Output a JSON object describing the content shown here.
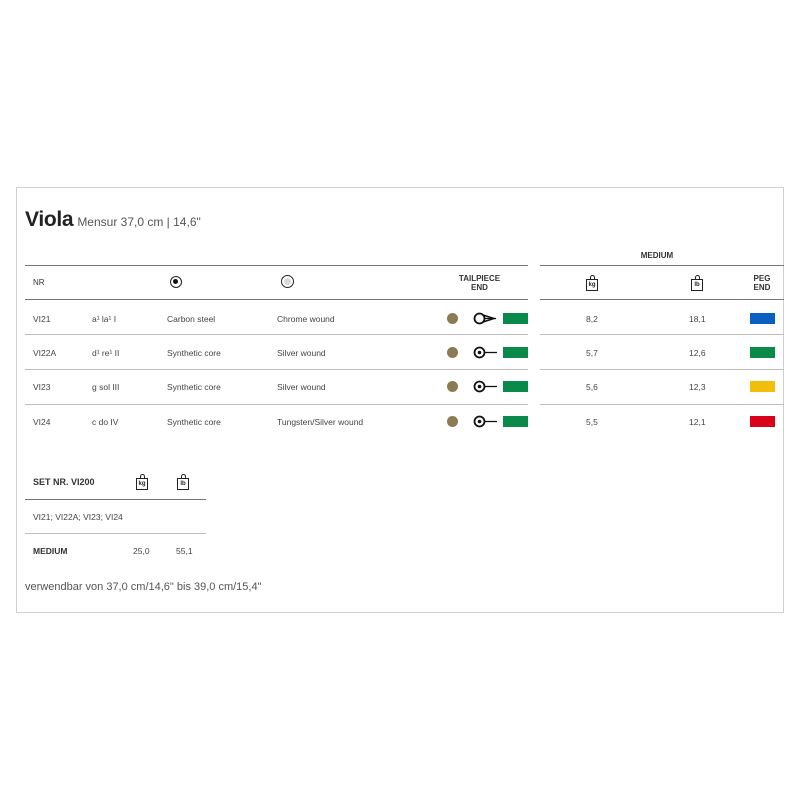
{
  "title": {
    "name": "Viola",
    "subtitle": "Mensur 37,0 cm | 14,6\""
  },
  "header": {
    "nr": "NR",
    "tailpiece_end": [
      "TAILPIECE",
      "END"
    ],
    "medium": "MEDIUM",
    "kg": "kg",
    "lb": "lb",
    "peg_end": [
      "PEG",
      "END"
    ]
  },
  "rows": [
    {
      "nr": "VI21",
      "note": "a¹  la¹  I",
      "core": "Carbon steel",
      "winding": "Chrome wound",
      "tailpiece_icon": "loop-arrow-icon",
      "kg": "8,2",
      "lb": "18,1",
      "peg_color": "#0a5fc0"
    },
    {
      "nr": "VI22A",
      "note": "d¹  re¹  II",
      "core": "Synthetic core",
      "winding": "Silver wound",
      "tailpiece_icon": "ball-end-icon",
      "kg": "5,7",
      "lb": "12,6",
      "peg_color": "#0a8a4a"
    },
    {
      "nr": "VI23",
      "note": "g  sol  III",
      "core": "Synthetic core",
      "winding": "Silver wound",
      "tailpiece_icon": "ball-end-icon",
      "kg": "5,6",
      "lb": "12,3",
      "peg_color": "#f2be0c"
    },
    {
      "nr": "VI24",
      "note": "c  do  IV",
      "core": "Synthetic core",
      "winding": "Tungsten/Silver wound",
      "tailpiece_icon": "ball-end-icon",
      "kg": "5,5",
      "lb": "12,1",
      "peg_color": "#d9001b"
    }
  ],
  "colors": {
    "tailpiece_dot": "#8c7a52",
    "tailpiece_bar": "#0a8a4a"
  },
  "set": {
    "label": "SET NR. VI200",
    "kg": "kg",
    "lb": "lb",
    "contents": "VI21; VI22A; VI23; VI24",
    "tension_label": "MEDIUM",
    "kg_value": "25,0",
    "lb_value": "55,1"
  },
  "footer": "verwendbar von 37,0 cm/14,6\" bis 39,0 cm/15,4\""
}
